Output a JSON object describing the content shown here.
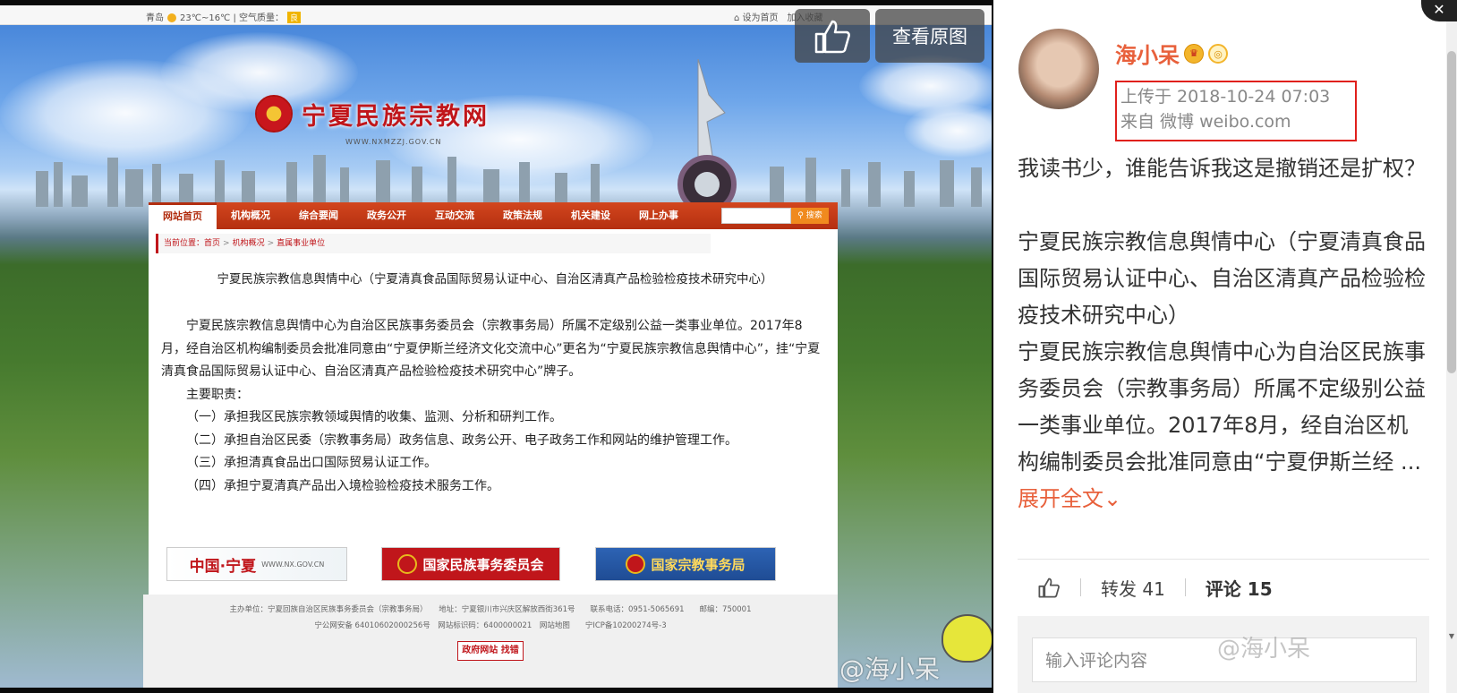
{
  "screenshot": {
    "topbar": {
      "city": "青岛",
      "weather": "23℃~16℃ | 空气质量：",
      "aqi": "良",
      "set_home": "设为首页",
      "add_fav": "加入收藏"
    },
    "site_name": "宁夏民族宗教网",
    "site_url": "WWW.NXMZZJ.GOV.CN",
    "nav": [
      "网站首页",
      "机构概况",
      "综合要闻",
      "政务公开",
      "互动交流",
      "政策法规",
      "机关建设",
      "网上办事"
    ],
    "search_button": "搜索",
    "breadcrumb": {
      "prefix": "当前位置：",
      "items": [
        "首页",
        "机构概况",
        "直属事业单位"
      ]
    },
    "article_title": "宁夏民族宗教信息舆情中心（宁夏清真食品国际贸易认证中心、自治区清真产品检验检疫技术研究中心）",
    "paragraphs": [
      "宁夏民族宗教信息舆情中心为自治区民族事务委员会（宗教事务局）所属不定级别公益一类事业单位。2017年8月，经自治区机构编制委员会批准同意由“宁夏伊斯兰经济文化交流中心”更名为“宁夏民族宗教信息舆情中心”，挂“宁夏清真食品国际贸易认证中心、自治区清真产品检验检疫技术研究中心”牌子。",
      "主要职责：",
      "（一）承担我区民族宗教领域舆情的收集、监测、分析和研判工作。",
      "（二）承担自治区民委（宗教事务局）政务信息、政务公开、电子政务工作和网站的维护管理工作。",
      "（三）承担清真食品出口国际贸易认证工作。",
      "（四）承担宁夏清真产品出入境检验检疫技术服务工作。"
    ],
    "banners": [
      {
        "title": "中国·宁夏",
        "sub": "WWW.NX.GOV.CN"
      },
      {
        "title": "国家民族事务委员会"
      },
      {
        "title": "国家宗教事务局"
      }
    ],
    "footer": {
      "line1": "主办单位：宁夏回族自治区民族事务委员会（宗教事务局）　　地址：宁夏银川市兴庆区解放西街361号　　联系电话：0951-5065691　　邮编：750001",
      "line2": "宁公网安备 64010602000256号　网站标识码：6400000021　网站地图　　宁ICP备10200274号-3",
      "gov_badge": "政府网站",
      "gov_badge_sub": "找错"
    },
    "watermark": "@海小呆",
    "overlay_like_icon": "thumb-up-icon",
    "view_original": "查看原图"
  },
  "panel": {
    "username": "海小呆",
    "upload_time": "上传于 2018-10-24 07:03",
    "source": "来自 微博 weibo.com",
    "post_text_1": "我读书少，谁能告诉我这是撤销还是扩权？",
    "post_text_2": "宁夏民族宗教信息舆情中心（宁夏清真食品国际贸易认证中心、自治区清真产品检验检疫技术研究中心）",
    "post_text_3": "宁夏民族宗教信息舆情中心为自治区民族事务委员会（宗教事务局）所属不定级别公益一类事业单位。2017年8月，经自治区机构编制委员会批准同意由“宁夏伊斯兰经 ... ",
    "expand": "展开全文",
    "repost": "转发 41",
    "comment": "评论 15",
    "comment_placeholder": "输入评论内容",
    "watermark": "@海小呆"
  }
}
